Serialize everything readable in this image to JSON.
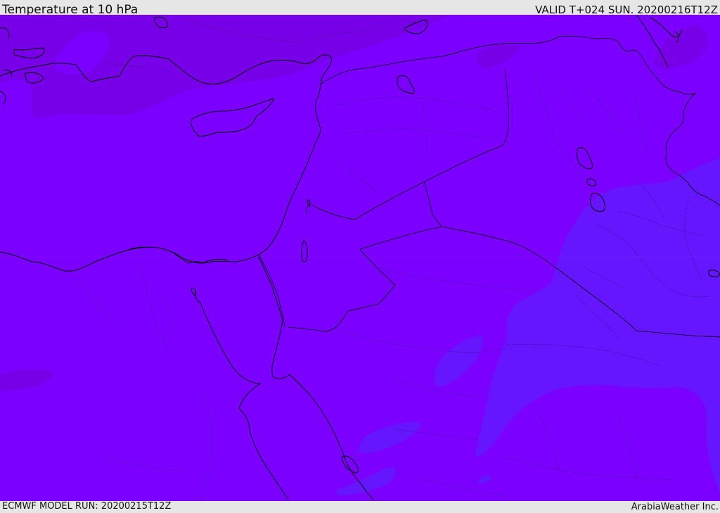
{
  "header": {
    "title": "Temperature at 10 hPa",
    "valid": "VALID T+024 SUN. 20200216T12Z"
  },
  "footer": {
    "model_run": "ECMWF MODEL RUN: 20200215T12Z",
    "credit": "ArabiaWeather Inc."
  },
  "colors": {
    "field_main": "#7b00ff",
    "field_warm": "#7800e8",
    "field_cool": "#6616ff",
    "coastline": "#000000",
    "frame": "#e6e6e6"
  }
}
